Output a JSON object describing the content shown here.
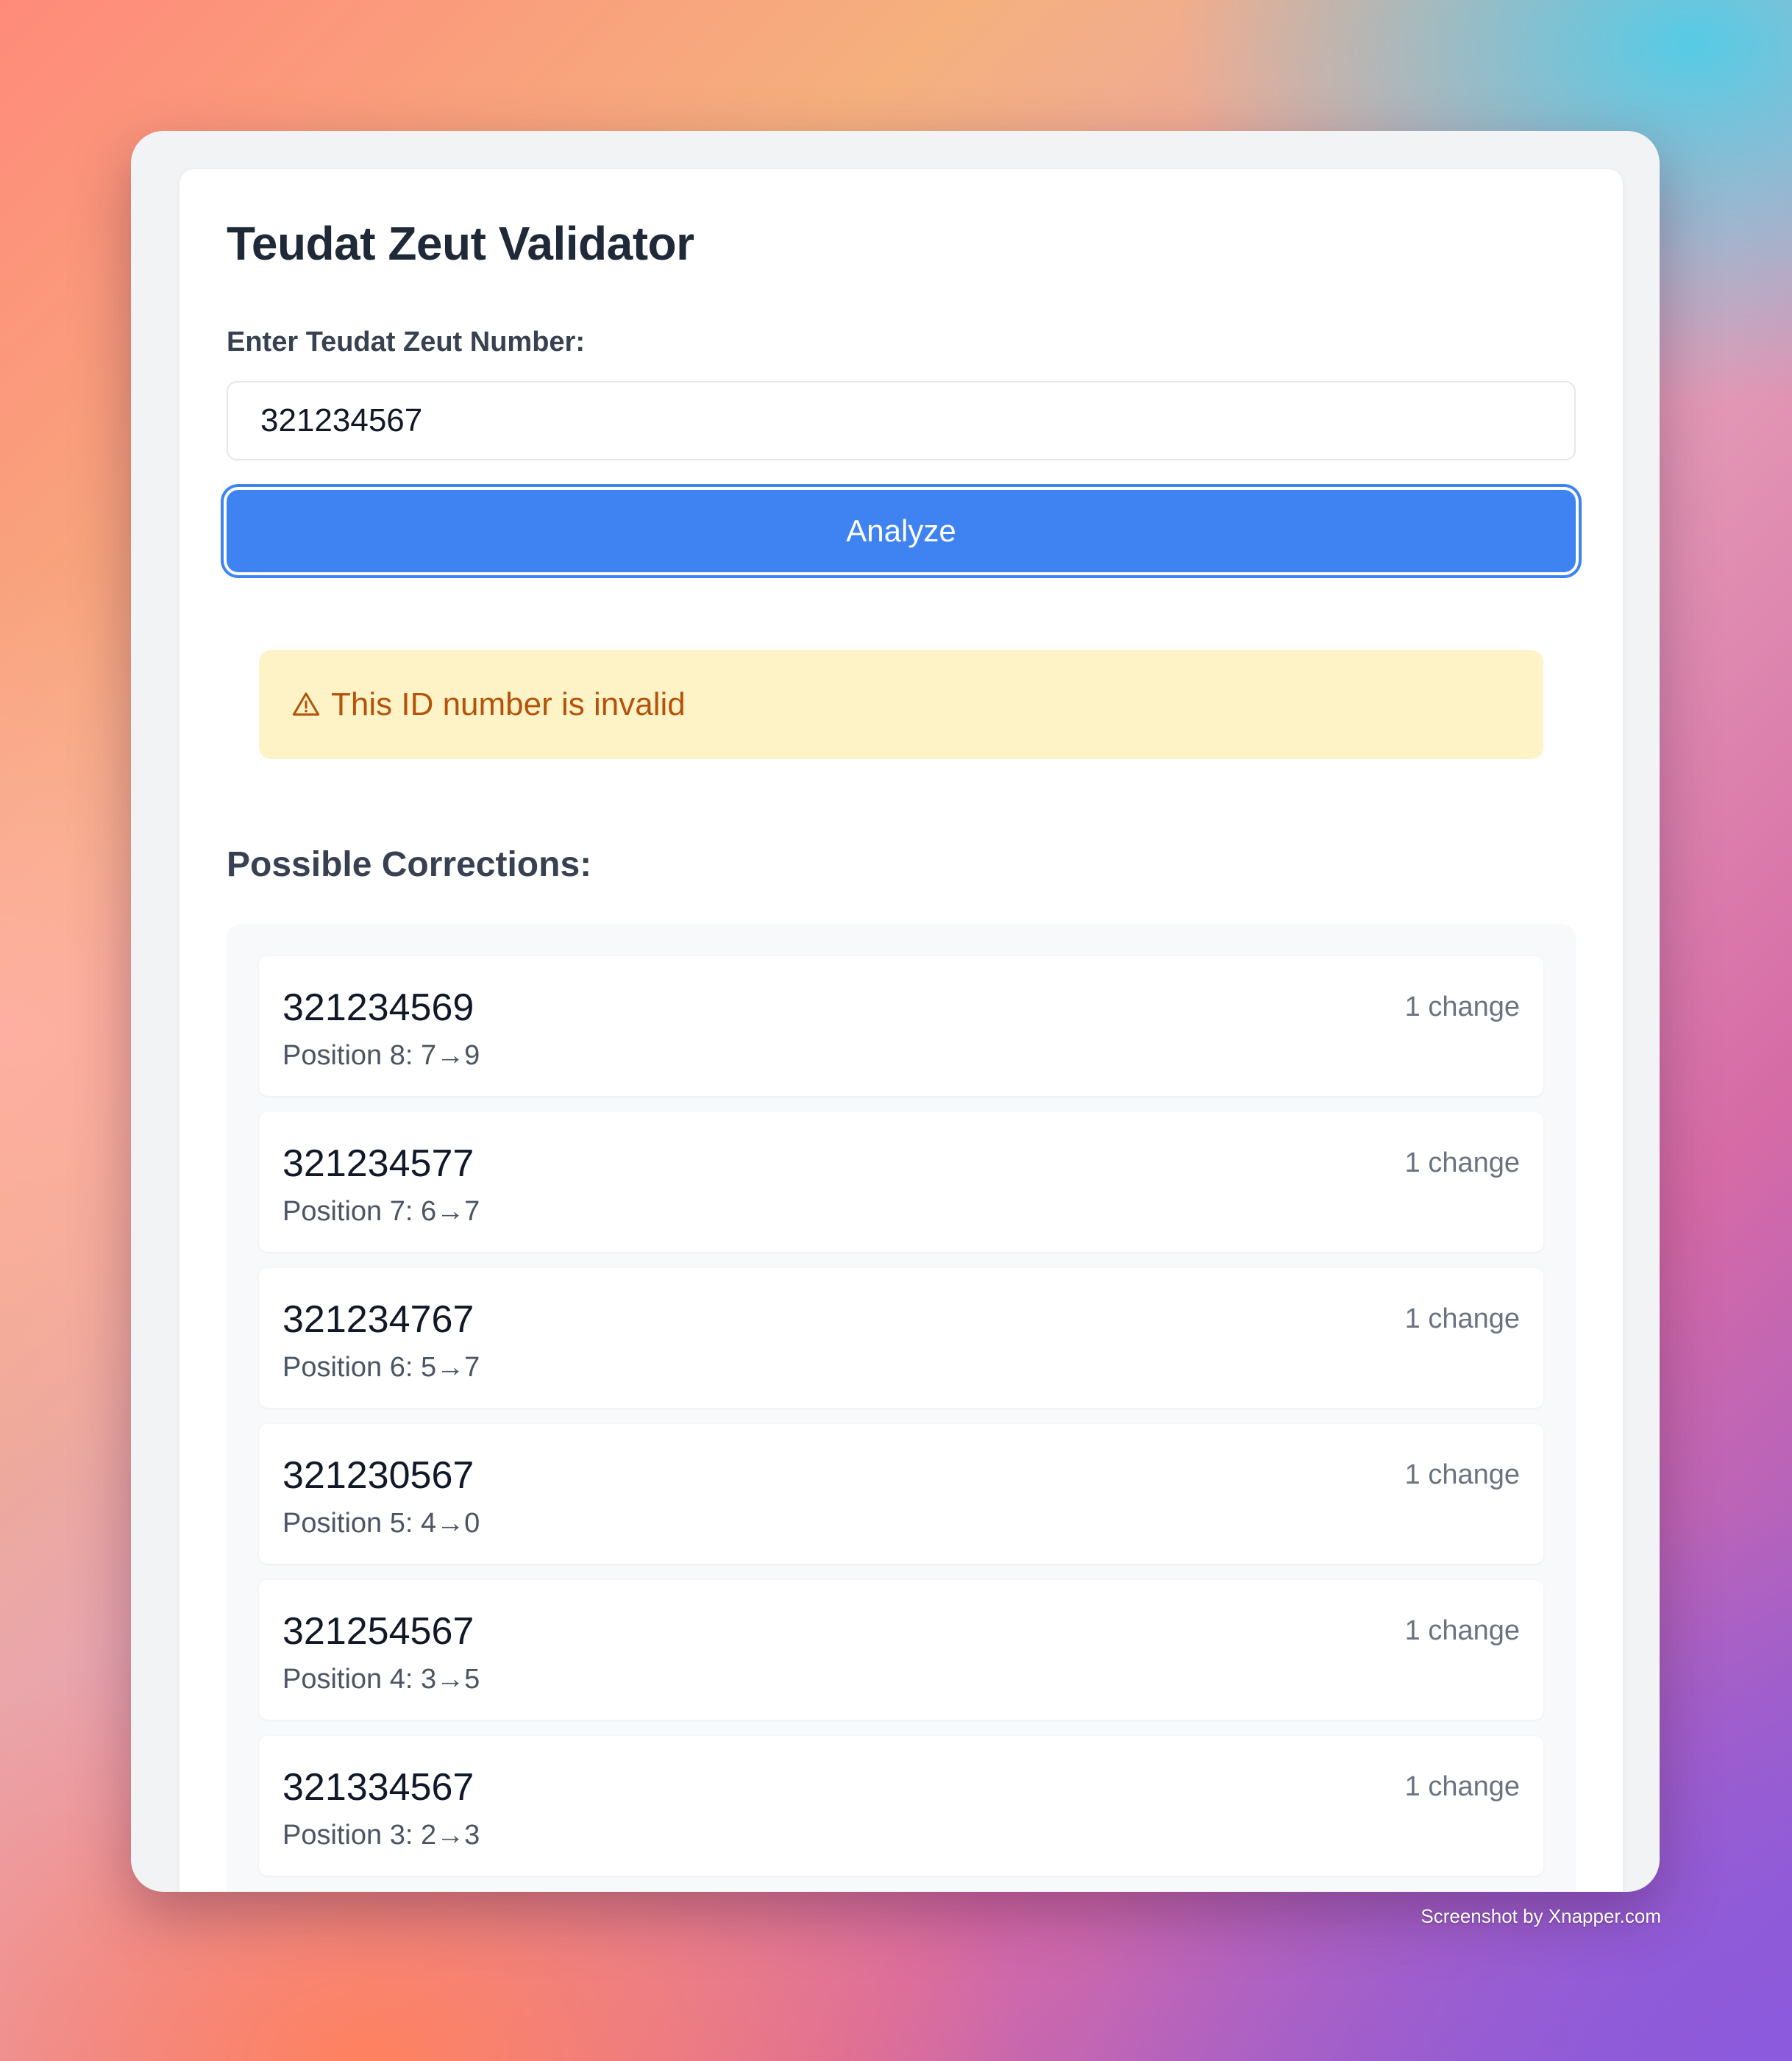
{
  "app": {
    "title": "Teudat Zeut Validator"
  },
  "form": {
    "label": "Enter Teudat Zeut Number:",
    "input_value": "321234567",
    "button_label": "Analyze"
  },
  "alert": {
    "icon": "warning-triangle-icon",
    "message": "This ID number is invalid",
    "color": "#b45309",
    "background": "#fef3c7"
  },
  "corrections": {
    "title": "Possible Corrections:",
    "items": [
      {
        "number": "321234569",
        "detail": "Position 8: 7→9",
        "changes": "1 change"
      },
      {
        "number": "321234577",
        "detail": "Position 7: 6→7",
        "changes": "1 change"
      },
      {
        "number": "321234767",
        "detail": "Position 6: 5→7",
        "changes": "1 change"
      },
      {
        "number": "321230567",
        "detail": "Position 5: 4→0",
        "changes": "1 change"
      },
      {
        "number": "321254567",
        "detail": "Position 4: 3→5",
        "changes": "1 change"
      },
      {
        "number": "321334567",
        "detail": "Position 3: 2→3",
        "changes": "1 change"
      }
    ]
  },
  "footer": {
    "watermark": "Screenshot by Xnapper.com"
  },
  "colors": {
    "accent": "#3f83f3",
    "title": "#1f2937"
  }
}
